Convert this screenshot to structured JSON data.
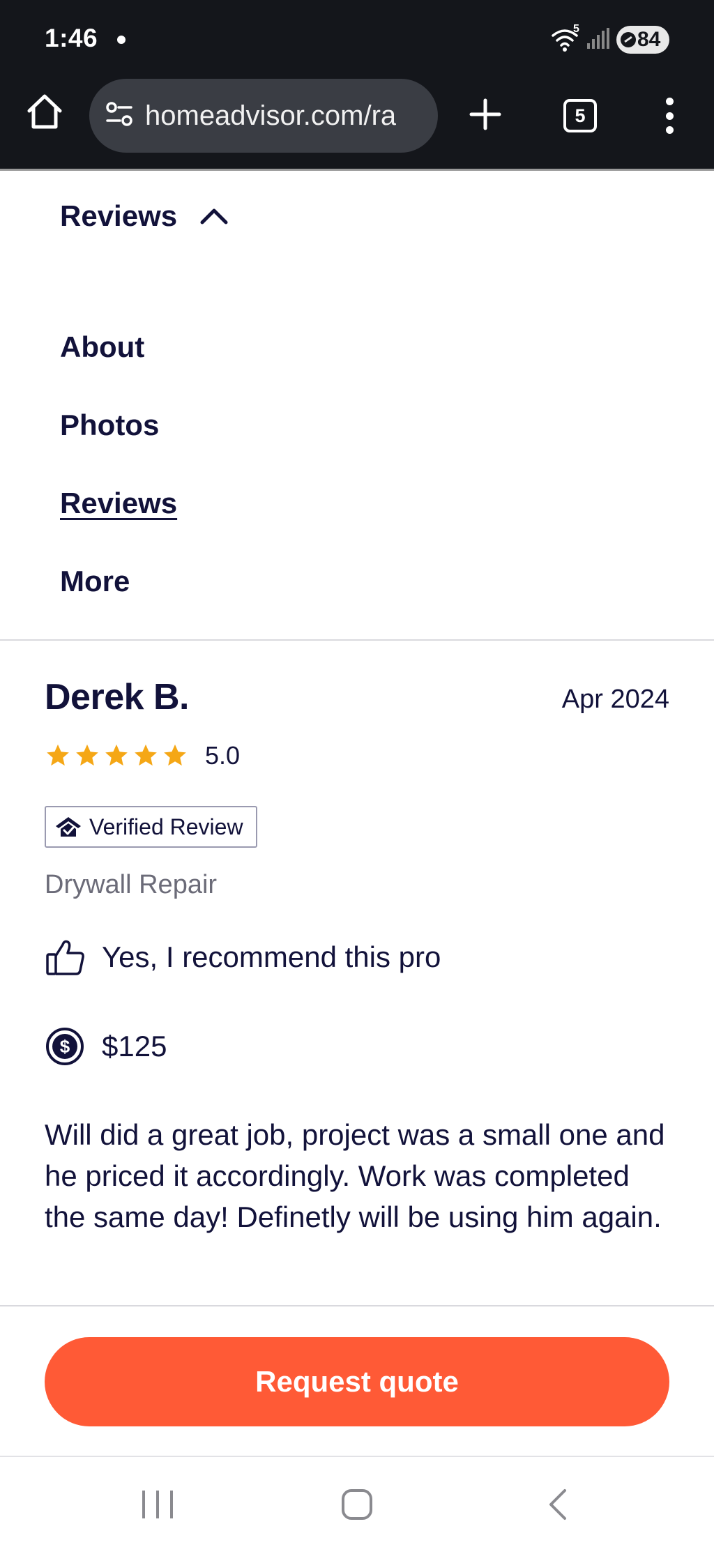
{
  "status_bar": {
    "time": "1:46",
    "wifi_badge": "5",
    "battery": "84"
  },
  "browser": {
    "url": "homeadvisor.com/ra",
    "tab_count": "5",
    "icons": [
      "home-icon",
      "tune-icon",
      "plus-icon",
      "tabs-icon",
      "more-vert-icon"
    ]
  },
  "nav": {
    "toggle_label": "Reviews",
    "items": [
      {
        "label": "About",
        "active": false
      },
      {
        "label": "Photos",
        "active": false
      },
      {
        "label": "Reviews",
        "active": true
      },
      {
        "label": "More",
        "active": false
      }
    ]
  },
  "review": {
    "reviewer": "Derek B.",
    "date": "Apr 2024",
    "rating": "5.0",
    "stars": 5,
    "verified_label": "Verified Review",
    "service": "Drywall Repair",
    "recommendation": "Yes, I recommend this pro",
    "cost": "$125",
    "body": "Will did a great job, project was a small one and he priced it accordingly. Work was completed the same day! Definetly will be using him again."
  },
  "cta": {
    "label": "Request quote"
  },
  "colors": {
    "brand_dark": "#12123a",
    "accent": "#ff5a36",
    "star": "#f5a716",
    "topbar": "#14161b"
  }
}
